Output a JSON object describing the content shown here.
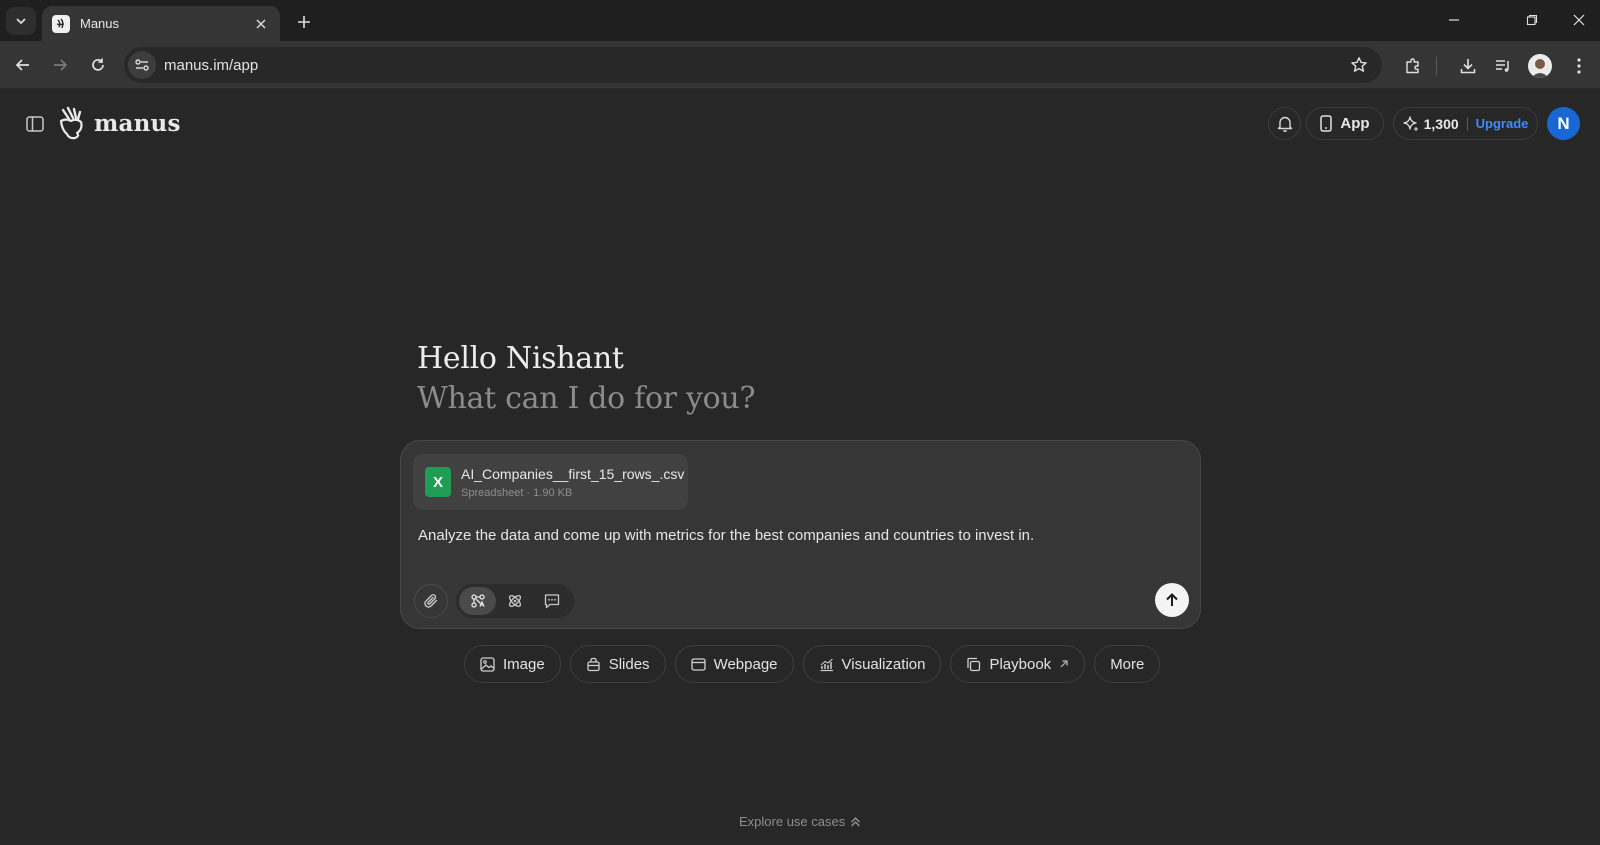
{
  "browser": {
    "tab_title": "Manus",
    "url": "manus.im/app"
  },
  "header": {
    "logo_text": "manus",
    "app_label": "App",
    "credits": "1,300",
    "upgrade_label": "Upgrade",
    "avatar_initial": "N"
  },
  "greeting": {
    "title": "Hello Nishant",
    "subtitle": "What can I do for you?"
  },
  "composer": {
    "attachment": {
      "name": "AI_Companies__first_15_rows_.csv",
      "meta": "Spreadsheet · 1.90 KB",
      "icon_letter": "X"
    },
    "prompt": "Analyze the data and come up with metrics for the best companies and countries to invest in."
  },
  "chips": [
    {
      "label": "Image",
      "icon": "image-icon"
    },
    {
      "label": "Slides",
      "icon": "slides-icon"
    },
    {
      "label": "Webpage",
      "icon": "webpage-icon"
    },
    {
      "label": "Visualization",
      "icon": "chart-icon"
    },
    {
      "label": "Playbook",
      "icon": "playbook-icon"
    },
    {
      "label": "More",
      "icon": ""
    }
  ],
  "footer": {
    "explore_label": "Explore use cases"
  },
  "colors": {
    "background": "#272727",
    "accent_blue": "#3d8bfd",
    "avatar_blue": "#1967d2",
    "spreadsheet_green": "#1f9d55"
  }
}
